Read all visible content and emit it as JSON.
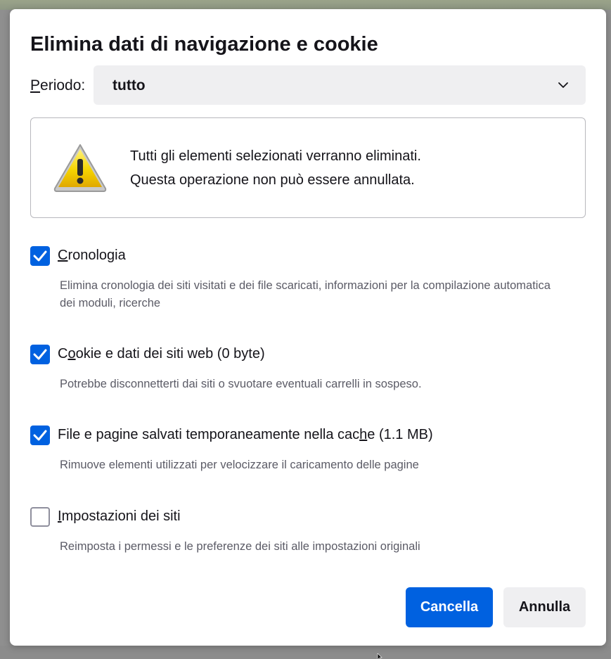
{
  "dialog": {
    "title": "Elimina dati di navigazione e cookie",
    "period": {
      "label": "Periodo:",
      "selected": "tutto"
    },
    "warning": {
      "line1": "Tutti gli elementi selezionati verranno eliminati.",
      "line2": "Questa operazione non può essere annullata."
    },
    "options": [
      {
        "label_pre": "",
        "label_key": "C",
        "label_post": "ronologia",
        "description": "Elimina cronologia dei siti visitati e dei file scaricati, informazioni per la compilazione automatica dei moduli, ricerche",
        "checked": true
      },
      {
        "label_pre": "C",
        "label_key": "o",
        "label_post": "okie e dati dei siti web (0 byte)",
        "description": "Potrebbe disconnetterti dai siti o svuotare eventuali carrelli in sospeso.",
        "checked": true
      },
      {
        "label_pre": "File e pagine salvati temporaneamente nella cac",
        "label_key": "h",
        "label_post": "e (1.1 MB)",
        "description": "Rimuove elementi utilizzati per velocizzare il caricamento delle pagine",
        "checked": true
      },
      {
        "label_pre": "",
        "label_key": "I",
        "label_post": "mpostazioni dei siti",
        "description": "Reimposta i permessi e le preferenze dei siti alle impostazioni originali",
        "checked": false
      }
    ],
    "buttons": {
      "confirm": "Cancella",
      "cancel": "Annulla"
    }
  },
  "colors": {
    "accent": "#0061e0",
    "text": "#15141a",
    "secondary_text": "#5b5b66",
    "button_secondary_bg": "#efeff1",
    "warning_yellow": "#f5c400"
  },
  "icons": {
    "warning": "warning-triangle-icon",
    "dropdown": "chevron-down-icon",
    "checkmark": "checkmark-icon"
  }
}
